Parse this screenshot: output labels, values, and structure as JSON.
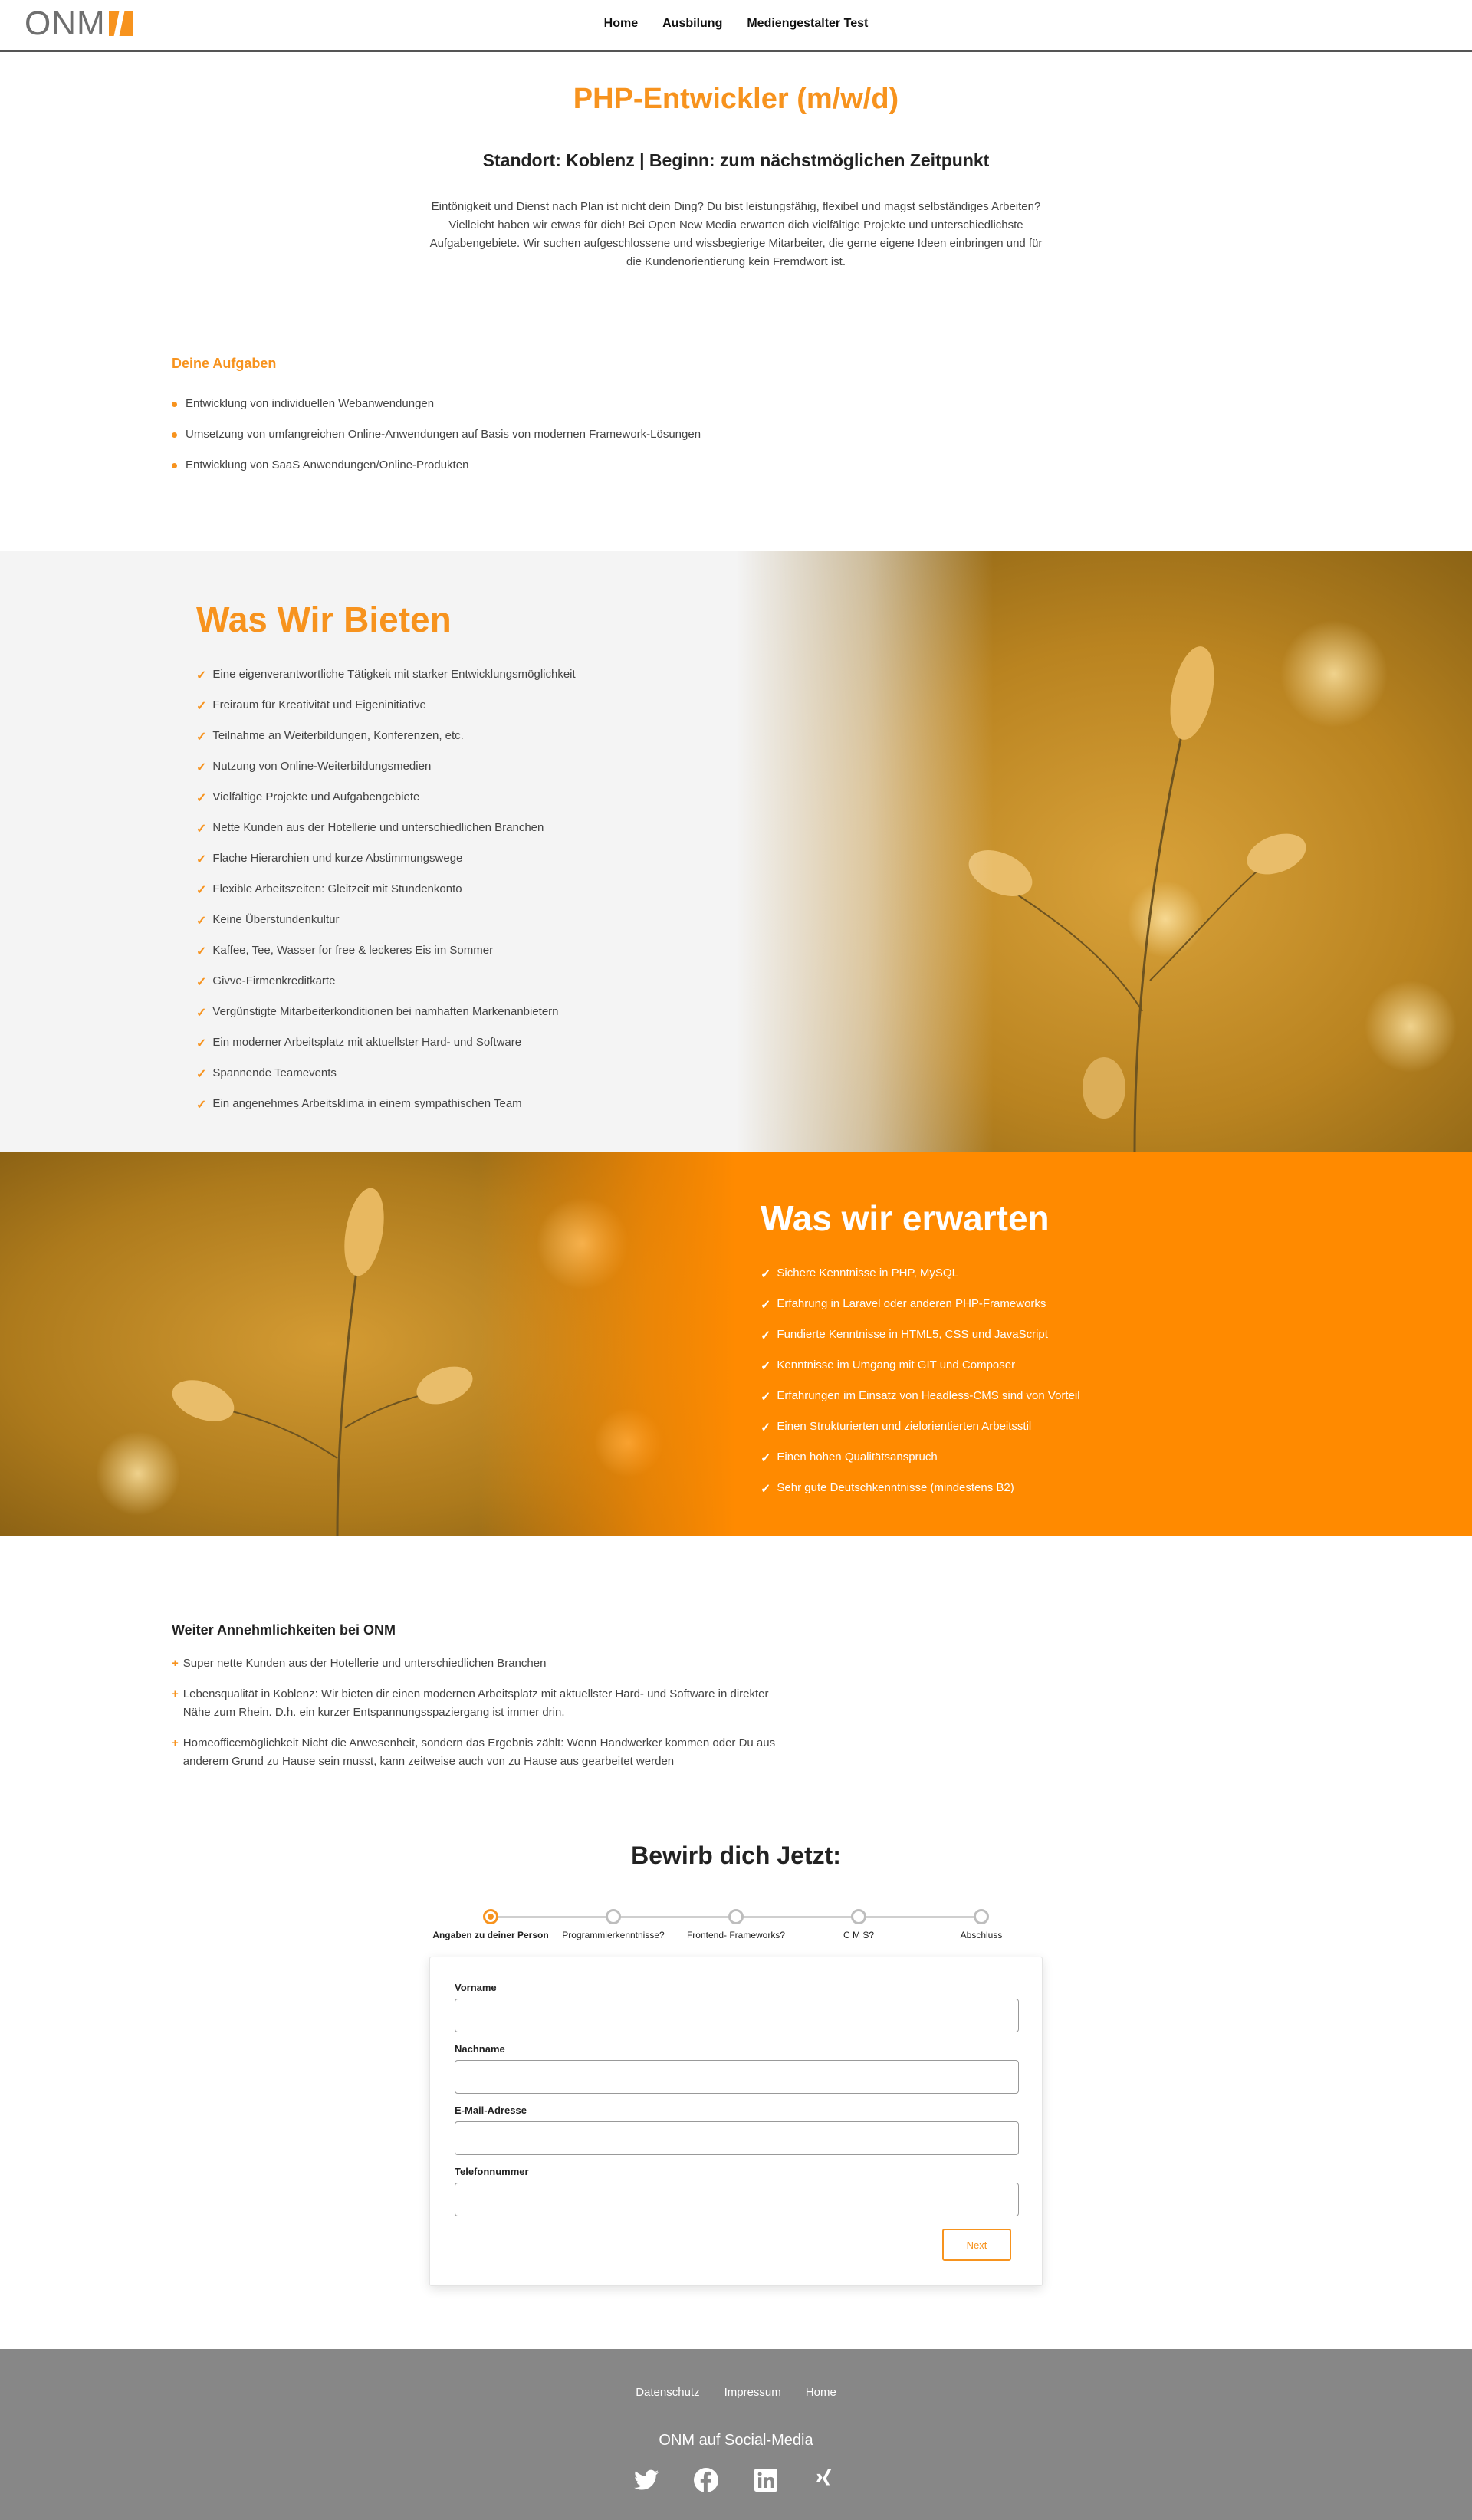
{
  "header": {
    "logo_text": "ONM",
    "nav": [
      {
        "label": "Home"
      },
      {
        "label": "Ausbilung"
      },
      {
        "label": "Mediengestalter Test"
      }
    ]
  },
  "job": {
    "title": "PHP-Entwickler (m/w/d)",
    "subtitle": "Standort: Koblenz | Beginn: zum nächstmöglichen Zeitpunkt",
    "intro": "Eintönigkeit und Dienst nach Plan ist nicht dein Ding? Du bist leistungsfähig, flexibel und magst selbständiges Arbeiten? Vielleicht haben wir etwas für dich! Bei Open New Media erwarten dich vielfältige Projekte und unterschiedlichste Aufgabengebiete. Wir suchen aufgeschlossene und wissbegierige Mitarbeiter, die gerne eigene Ideen einbringen und für die Kundenorientierung kein Fremdwort ist."
  },
  "tasks": {
    "title": "Deine Aufgaben",
    "items": [
      "Entwicklung von individuellen Webanwendungen",
      "Umsetzung von umfangreichen Online-Anwendungen auf Basis von modernen Framework-Lösungen",
      "Entwicklung von SaaS Anwendungen/Online-Produkten"
    ]
  },
  "bieten": {
    "title": "Was Wir Bieten",
    "items": [
      "Eine eigenverantwortliche Tätigkeit mit starker Entwicklungsmöglichkeit",
      "Freiraum für Kreativität und Eigeninitiative",
      "Teilnahme an Weiterbildungen, Konferenzen, etc.",
      "Nutzung von Online-Weiterbildungsmedien",
      "Vielfältige Projekte und Aufgabengebiete",
      "Nette Kunden aus der Hotellerie und unterschiedlichen Branchen",
      "Flache Hierarchien und kurze Abstimmungswege",
      "Flexible Arbeitszeiten: Gleitzeit mit Stundenkonto",
      "Keine Überstundenkultur",
      "Kaffee, Tee, Wasser for free & leckeres Eis im Sommer",
      "Givve-Firmenkreditkarte",
      "Vergünstigte Mitarbeiterkonditionen bei namhaften Markenanbietern",
      "Ein moderner Arbeitsplatz mit aktuellster Hard- und Software",
      "Spannende Teamevents",
      "Ein angenehmes Arbeitsklima in einem sympathischen Team"
    ]
  },
  "erwarten": {
    "title": "Was wir erwarten",
    "items": [
      "Sichere Kenntnisse in PHP, MySQL",
      "Erfahrung in Laravel oder anderen PHP-Frameworks",
      "Fundierte Kenntnisse in HTML5, CSS und JavaScript",
      "Kenntnisse im Umgang mit GIT und Composer",
      "Erfahrungen im Einsatz von Headless-CMS sind von Vorteil",
      "Einen Strukturierten und zielorientierten Arbeitsstil",
      "Einen hohen Qualitätsanspruch",
      "Sehr gute Deutschkenntnisse (mindestens B2)"
    ]
  },
  "weiter": {
    "title": "Weiter Annehmlichkeiten bei ONM",
    "items": [
      "Super nette Kunden aus der Hotellerie und unterschiedlichen Branchen",
      "Lebensqualität in Koblenz: Wir bieten dir einen modernen Arbeitsplatz mit aktuellster Hard- und Software in direkter Nähe zum Rhein. D.h. ein kurzer Entspannungsspaziergang ist immer drin.",
      "Homeofficemöglichkeit Nicht die Anwesenheit, sondern das Ergebnis zählt: Wenn Handwerker kommen oder Du aus anderem Grund zu Hause sein musst, kann zeitweise auch von zu Hause aus gearbeitet werden"
    ]
  },
  "apply": {
    "title": "Bewirb dich Jetzt:",
    "steps": [
      {
        "label": "Angaben zu deiner Person",
        "active": true
      },
      {
        "label": "Programmierkenntnisse?",
        "active": false
      },
      {
        "label": "Frontend- Frameworks?",
        "active": false
      },
      {
        "label": "C M S?",
        "active": false
      },
      {
        "label": "Abschluss",
        "active": false
      }
    ],
    "fields": [
      {
        "label": "Vorname",
        "value": ""
      },
      {
        "label": "Nachname",
        "value": ""
      },
      {
        "label": "E-Mail-Adresse",
        "value": ""
      },
      {
        "label": "Telefonnummer",
        "value": ""
      }
    ],
    "next_label": "Next"
  },
  "footer": {
    "links": [
      {
        "label": "Datenschutz"
      },
      {
        "label": "Impressum"
      },
      {
        "label": "Home"
      }
    ],
    "social_title": "ONM auf Social-Media",
    "social_icons": [
      "twitter-icon",
      "facebook-icon",
      "linkedin-icon",
      "xing-icon"
    ]
  },
  "colors": {
    "accent": "#f7931e",
    "erwarten_bg": "#ff8a00",
    "bieten_bg": "#f4f4f4",
    "footer_bg": "#878787"
  }
}
